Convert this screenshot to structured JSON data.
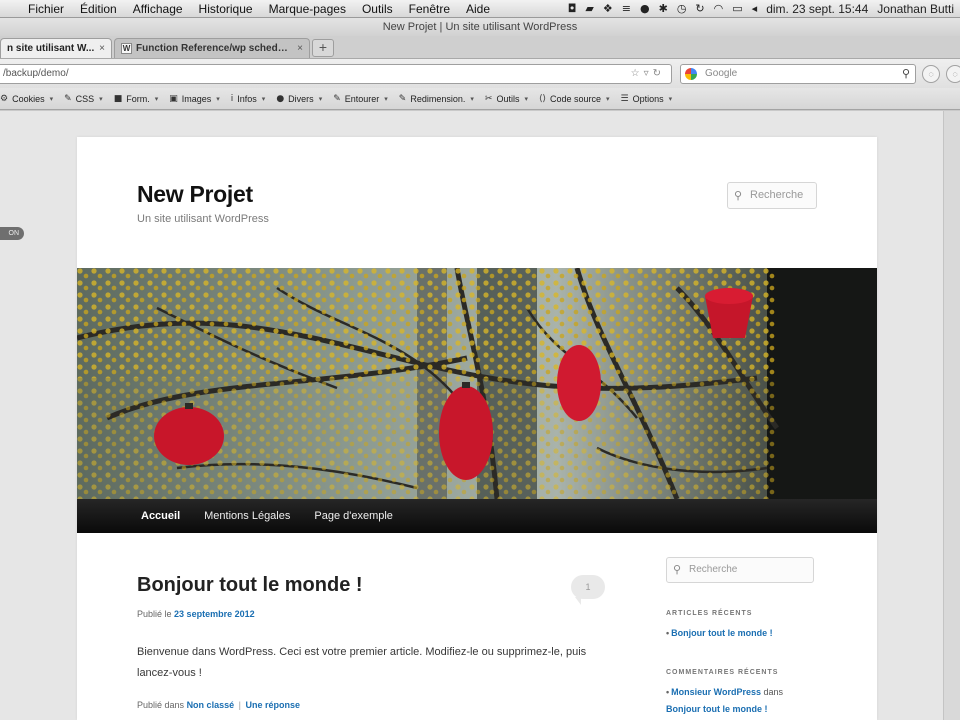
{
  "menubar": {
    "apple": "",
    "items": [
      "Fichier",
      "Édition",
      "Affichage",
      "Historique",
      "Marque-pages",
      "Outils",
      "Fenêtre",
      "Aide"
    ],
    "clock": "dim. 23 sept.  15:44",
    "user": "Jonathan Butti"
  },
  "window": {
    "title": "New Projet | Un site utilisant WordPress"
  },
  "tabs": [
    {
      "label": "n site utilisant W...",
      "close": "×"
    },
    {
      "label": "Function Reference/wp schedul...",
      "close": "×"
    }
  ],
  "newtab": "+",
  "address": {
    "url": "/backup/demo/"
  },
  "search_engine": {
    "placeholder": "Google"
  },
  "devtoolbar": [
    {
      "label": "Cookies",
      "icon": "cookie-icon",
      "glyph": "⚙"
    },
    {
      "label": "CSS",
      "icon": "css-icon",
      "glyph": "✎"
    },
    {
      "label": "Form.",
      "icon": "form-icon",
      "glyph": "■"
    },
    {
      "label": "Images",
      "icon": "images-icon",
      "glyph": "▣"
    },
    {
      "label": "Infos",
      "icon": "info-icon",
      "glyph": "i"
    },
    {
      "label": "Divers",
      "icon": "misc-icon",
      "glyph": "●"
    },
    {
      "label": "Entourer",
      "icon": "outline-icon",
      "glyph": "✎"
    },
    {
      "label": "Redimension.",
      "icon": "resize-icon",
      "glyph": "✎"
    },
    {
      "label": "Outils",
      "icon": "tools-icon",
      "glyph": "✂"
    },
    {
      "label": "Code source",
      "icon": "source-icon",
      "glyph": "⟨⟩"
    },
    {
      "label": "Options",
      "icon": "options-icon",
      "glyph": "☰"
    }
  ],
  "side_flag": "ON",
  "site": {
    "title": "New Projet",
    "description": "Un site utilisant WordPress",
    "search_placeholder": "Recherche"
  },
  "nav": [
    "Accueil",
    "Mentions Légales",
    "Page d'exemple"
  ],
  "post": {
    "title": "Bonjour tout le monde !",
    "comments": "1",
    "meta_prefix": "Publié le",
    "date": "23 septembre 2012",
    "body": "Bienvenue dans WordPress. Ceci est votre premier article. Modifiez-le ou supprimez-le, puis lancez-vous !",
    "foot_prefix": "Publié dans",
    "category": "Non classé",
    "separator": "|",
    "reply": "Une réponse"
  },
  "sidebar": {
    "search_placeholder": "Recherche",
    "recent_posts_title": "Articles récents",
    "recent_posts": [
      "Bonjour tout le monde !"
    ],
    "recent_comments_title": "Commentaires récents",
    "recent_comment_author": "Monsieur WordPress",
    "recent_comment_on": "dans",
    "recent_comment_post": "Bonjour tout le monde !"
  }
}
